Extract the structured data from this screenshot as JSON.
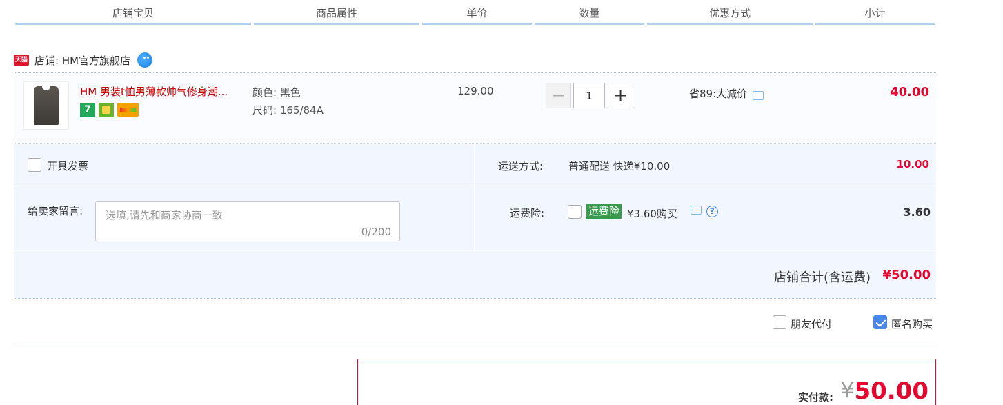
{
  "columns": {
    "shop_item": "店铺宝贝",
    "attributes": "商品属性",
    "unit_price": "单价",
    "quantity": "数量",
    "discount": "优惠方式",
    "subtotal": "小计"
  },
  "shop": {
    "badge": "天猫",
    "name": "店铺: HM官方旗舰店"
  },
  "item": {
    "title": "HM 男装t恤男薄款帅气修身潮...",
    "service_icon_7": "7",
    "attributes": [
      "颜色: 黑色",
      "尺码: 165/84A"
    ],
    "price": "129.00",
    "quantity": "1",
    "minus": "−",
    "plus": "+",
    "discount": "省89:大减价",
    "subtotal": "40.00"
  },
  "panel": {
    "invoice_label": "开具发票",
    "shipping_label": "运送方式:",
    "shipping_value": "普通配送 快递¥10.00",
    "shipping_amount": "10.00",
    "message_label": "给卖家留言:",
    "message_placeholder": "选填,请先和商家协商一致",
    "message_counter": "0/200",
    "insurance_label": "运费险:",
    "insurance_tag": "运费险",
    "insurance_value": "¥3.60购买",
    "insurance_help": "?",
    "insurance_amount": "3.60",
    "store_total_label": "店铺合计(含运费)",
    "store_total_value": "¥50.00"
  },
  "options": {
    "friend_pay": "朋友代付",
    "friend_pay_checked": false,
    "anonymous": "匿名购买",
    "anonymous_checked": true
  },
  "payment": {
    "label": "实付款:",
    "currency": "¥",
    "amount": "50.00"
  },
  "colors": {
    "accent_red": "#e4062f",
    "header_line": "#b2cff0",
    "panel_bg": "#f2f7ff",
    "insurance_green": "#3a9a4d",
    "checkbox_blue": "#4a86e8"
  }
}
